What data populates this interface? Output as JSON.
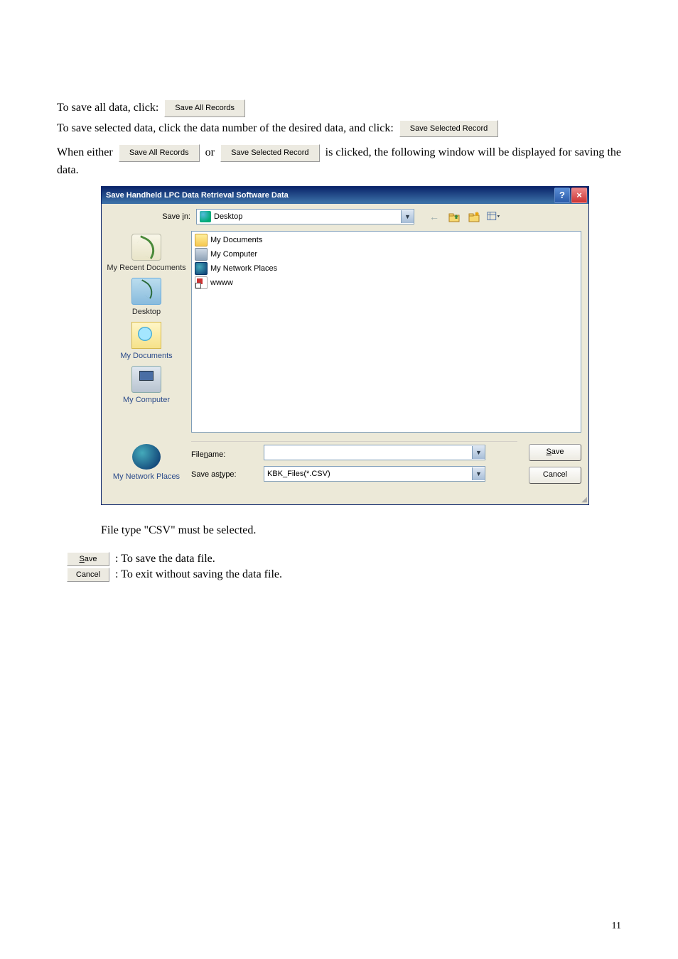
{
  "para1_pre": "To save all data, click:",
  "btn_save_all": "Save All Records",
  "para2_pre": "To save selected data, click the data number of the desired data, and click:",
  "btn_save_sel": "Save Selected Record",
  "para3_a": "When  either",
  "para3_b": "or",
  "para3_c": "is  clicked,  the  following  window  will  be displayed for saving the data.",
  "dialog": {
    "title": "Save Handheld LPC Data Retrieval Software Data",
    "savein_label": "Save in:",
    "savein_value": "Desktop",
    "files": {
      "f1": "My Documents",
      "f2": "My Computer",
      "f3": "My Network Places",
      "f4": "wwww"
    },
    "places": {
      "recent": "My Recent Documents",
      "desktop": "Desktop",
      "mydocs": "My Documents",
      "mycomp": "My Computer",
      "mynet": "My Network Places"
    },
    "filename_label": "File name:",
    "filename_value": "",
    "saveas_label": "Save as type:",
    "saveas_value": "KBK_Files(*.CSV)",
    "save_btn": "Save",
    "cancel_btn": "Cancel"
  },
  "note1": "File type \"CSV\" must be selected.",
  "explain_save": ": To save the data file.",
  "explain_cancel": ": To exit without saving the data file.",
  "page_num": "11"
}
